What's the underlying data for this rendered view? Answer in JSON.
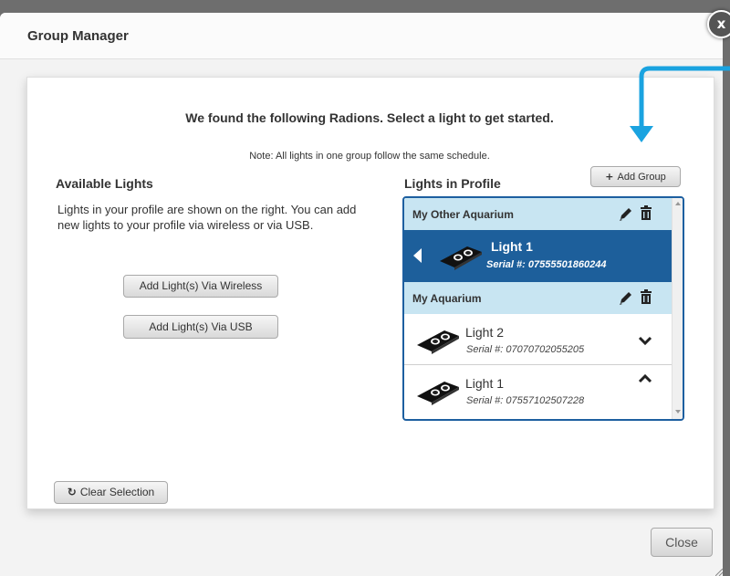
{
  "dialog": {
    "title": "Group Manager",
    "close_icon": "x-icon"
  },
  "main": {
    "headline": "We found the following Radions. Select a light to get started.",
    "note": "Note: All lights in one group follow the same schedule."
  },
  "available": {
    "title": "Available Lights",
    "description": "Lights in your profile are shown on the right. You can add new lights to your profile via wireless or via USB.",
    "wireless_button": "Add Light(s) Via Wireless",
    "usb_button": "Add Light(s) Via USB",
    "clear_button": "Clear Selection",
    "clear_icon": "refresh-icon"
  },
  "profile": {
    "title": "Lights in Profile",
    "add_group_button": "Add Group",
    "add_group_icon": "plus-icon",
    "groups": [
      {
        "name": "My Other Aquarium",
        "lights": [
          {
            "name": "Light 1",
            "serial": "Serial #: 07555501860244",
            "selected": true
          }
        ]
      },
      {
        "name": "My Aquarium",
        "lights": [
          {
            "name": "Light 2",
            "serial": "Serial #: 07070702055205",
            "control": "chevron-down-icon"
          },
          {
            "name": "Light 1",
            "serial": "Serial #: 07557102507228",
            "control": "chevron-up-icon"
          }
        ]
      }
    ]
  },
  "footer": {
    "close_button": "Close"
  },
  "colors": {
    "accent": "#1d5f9b",
    "group_header": "#c8e5f2",
    "callout_arrow": "#1aa3e0"
  }
}
